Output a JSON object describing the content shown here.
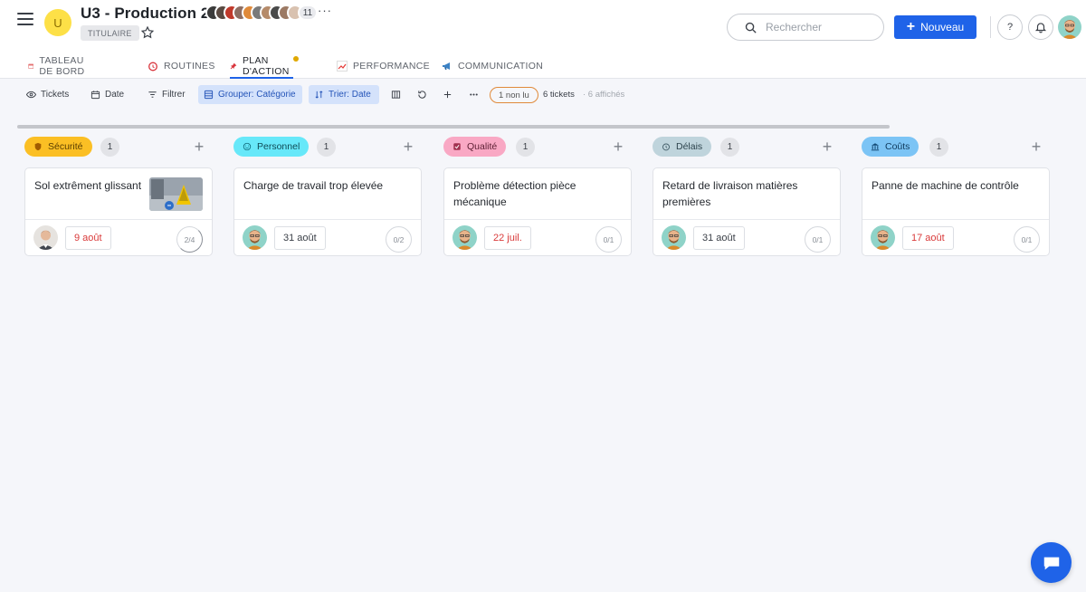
{
  "header": {
    "space_initial": "U",
    "space_title": "U3 - Production 2",
    "role_badge": "TITULAIRE",
    "member_count": "11",
    "more": "···",
    "search_placeholder": "Rechercher",
    "new_button": "Nouveau",
    "help": "?"
  },
  "tabs": [
    {
      "label": "TABLEAU DE BORD",
      "icon": "calendar-icon"
    },
    {
      "label": "ROUTINES",
      "icon": "alarm-icon"
    },
    {
      "label": "PLAN D'ACTION",
      "icon": "pin-icon"
    },
    {
      "label": "PERFORMANCE",
      "icon": "chart-icon"
    },
    {
      "label": "COMMUNICATION",
      "icon": "megaphone-icon"
    }
  ],
  "toolbar": {
    "tickets": "Tickets",
    "date": "Date",
    "filter": "Filtrer",
    "group": "Grouper: Catégorie",
    "sort": "Trier: Date",
    "unread": "1 non lu",
    "tickets_count": "6 tickets",
    "shown_count": "· 6 affichés"
  },
  "columns": [
    {
      "category": "Sécurité",
      "count": "1",
      "color": "#fbbf24",
      "text_color": "#5a3e00",
      "card": {
        "title": "Sol extrêment glissant",
        "due": "9 août",
        "late": true,
        "progress": "2/4"
      }
    },
    {
      "category": "Personnel",
      "count": "1",
      "color": "#67e8f9",
      "text_color": "#0f4a55",
      "card": {
        "title": "Charge de travail trop élevée",
        "due": "31 août",
        "late": false,
        "progress": "0/2"
      }
    },
    {
      "category": "Qualité",
      "count": "1",
      "color": "#f9a8c4",
      "text_color": "#5c1f33",
      "card": {
        "title": "Problème détection pièce mécanique",
        "due": "22 juil.",
        "late": true,
        "progress": "0/1"
      }
    },
    {
      "category": "Délais",
      "count": "1",
      "color": "#bfd4dc",
      "text_color": "#2c434c",
      "card": {
        "title": "Retard de livraison matières premières",
        "due": "31 août",
        "late": false,
        "progress": "0/1"
      }
    },
    {
      "category": "Coûts",
      "count": "1",
      "color": "#7cc4f5",
      "text_color": "#0f3a5c",
      "card": {
        "title": "Panne de machine de contrôle",
        "due": "17 août",
        "late": true,
        "progress": "0/1"
      }
    }
  ],
  "colors": {
    "accent": "#1f63e8",
    "late": "#d93a3a"
  }
}
